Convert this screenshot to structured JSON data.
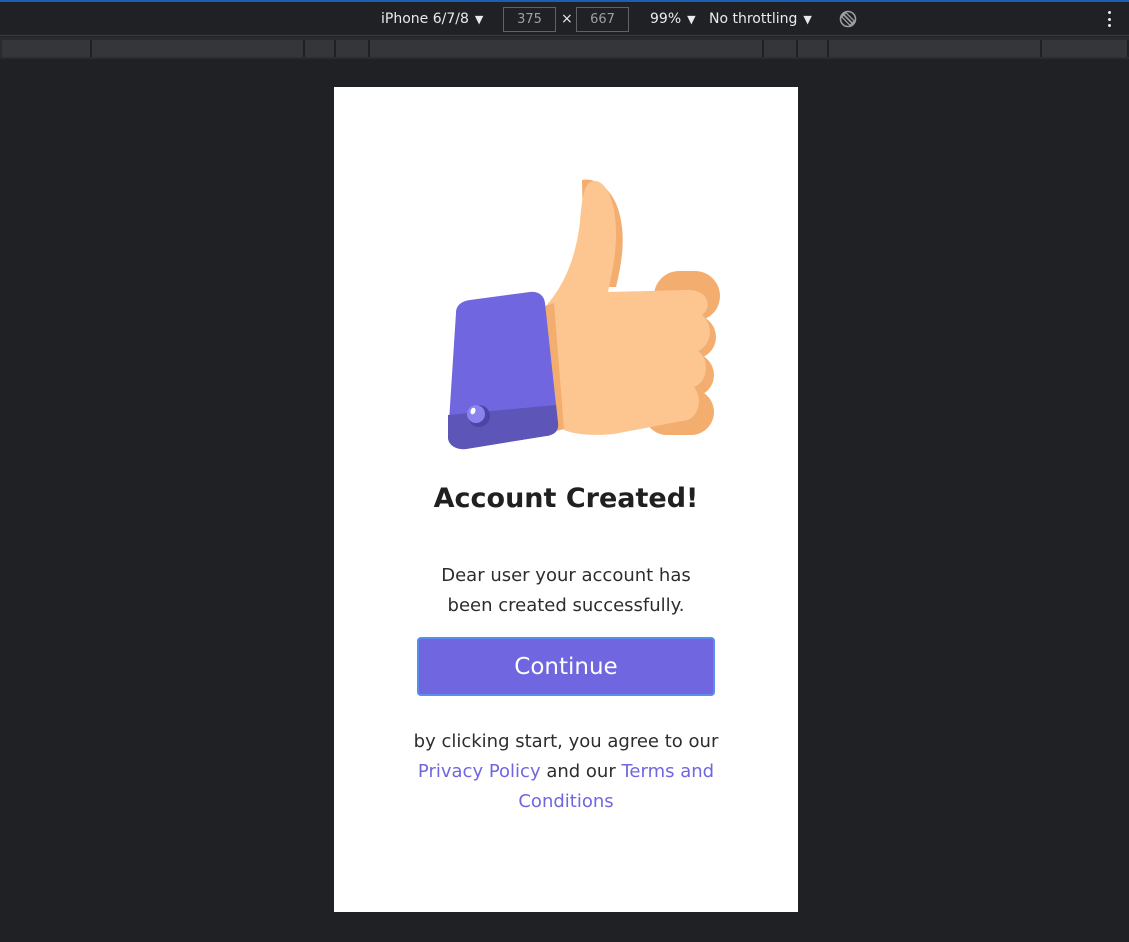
{
  "devtools": {
    "device_name": "iPhone 6/7/8",
    "width_value": "375",
    "height_value": "667",
    "dimension_separator": "×",
    "zoom": "99%",
    "throttling": "No throttling",
    "caret": "▼",
    "icons": {
      "rotate": "rotate-icon",
      "more": "more-options-icon"
    },
    "accent_color": "#1a5fb4"
  },
  "page": {
    "title": "Account Created!",
    "message": "Dear user your account has been created successfully.",
    "continue_label": "Continue",
    "legal_prefix": "by clicking start, you agree to our",
    "privacy_link": "Privacy Policy",
    "legal_middle": "and our",
    "terms_link": "Terms and Conditions",
    "illustration": "thumbs-up-icon",
    "colors": {
      "primary": "#7066e0",
      "skin": "#fdc691",
      "skin_shadow": "#f3ae6f",
      "sleeve": "#7066e0"
    }
  }
}
